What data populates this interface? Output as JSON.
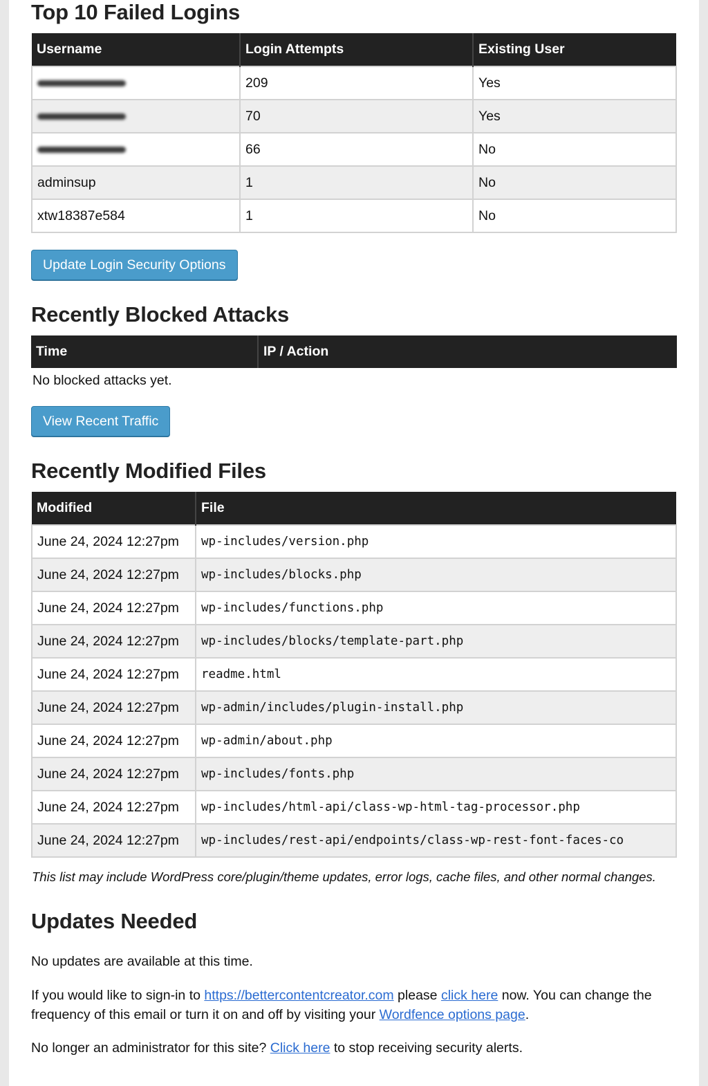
{
  "failed_logins": {
    "title": "Top 10 Failed Logins",
    "columns": [
      "Username",
      "Login Attempts",
      "Existing User"
    ],
    "rows": [
      {
        "username": "",
        "redacted": true,
        "attempts": "209",
        "existing": "Yes"
      },
      {
        "username": "",
        "redacted": true,
        "attempts": "70",
        "existing": "Yes"
      },
      {
        "username": "",
        "redacted": true,
        "attempts": "66",
        "existing": "No"
      },
      {
        "username": "adminsup",
        "redacted": false,
        "attempts": "1",
        "existing": "No"
      },
      {
        "username": "xtw18387e584",
        "redacted": false,
        "attempts": "1",
        "existing": "No"
      }
    ],
    "button_label": "Update Login Security Options"
  },
  "blocked_attacks": {
    "title": "Recently Blocked Attacks",
    "columns": [
      "Time",
      "IP / Action"
    ],
    "empty_text": "No blocked attacks yet.",
    "button_label": "View Recent Traffic"
  },
  "modified_files": {
    "title": "Recently Modified Files",
    "columns": [
      "Modified",
      "File"
    ],
    "rows": [
      {
        "modified": "June 24, 2024 12:27pm",
        "file": "wp-includes/version.php"
      },
      {
        "modified": "June 24, 2024 12:27pm",
        "file": "wp-includes/blocks.php"
      },
      {
        "modified": "June 24, 2024 12:27pm",
        "file": "wp-includes/functions.php"
      },
      {
        "modified": "June 24, 2024 12:27pm",
        "file": "wp-includes/blocks/template-part.php"
      },
      {
        "modified": "June 24, 2024 12:27pm",
        "file": "readme.html"
      },
      {
        "modified": "June 24, 2024 12:27pm",
        "file": "wp-admin/includes/plugin-install.php"
      },
      {
        "modified": "June 24, 2024 12:27pm",
        "file": "wp-admin/about.php"
      },
      {
        "modified": "June 24, 2024 12:27pm",
        "file": "wp-includes/fonts.php"
      },
      {
        "modified": "June 24, 2024 12:27pm",
        "file": "wp-includes/html-api/class-wp-html-tag-processor.php"
      },
      {
        "modified": "June 24, 2024 12:27pm",
        "file": "wp-includes/rest-api/endpoints/class-wp-rest-font-faces-co"
      }
    ],
    "note": "This list may include WordPress core/plugin/theme updates, error logs, cache files, and other normal changes."
  },
  "updates": {
    "title": "Updates Needed",
    "status_text": "No updates are available at this time.",
    "signin": {
      "prefix": "If you would like to sign-in to ",
      "site_link": "https://bettercontentcreator.com",
      "middle": " please ",
      "click_link": "click here",
      "suffix": " now. You can change the frequency of this email or turn it on and off by visiting your ",
      "options_link": "Wordfence options page",
      "end": "."
    },
    "unsubscribe": {
      "prefix": "No longer an administrator for this site? ",
      "link": "Click here",
      "suffix": " to stop receiving security alerts."
    }
  },
  "colors": {
    "header_bg": "#222222",
    "button_bg": "#4a9ccb",
    "link": "#2a6bd1",
    "row_alt": "#eeeeee"
  }
}
